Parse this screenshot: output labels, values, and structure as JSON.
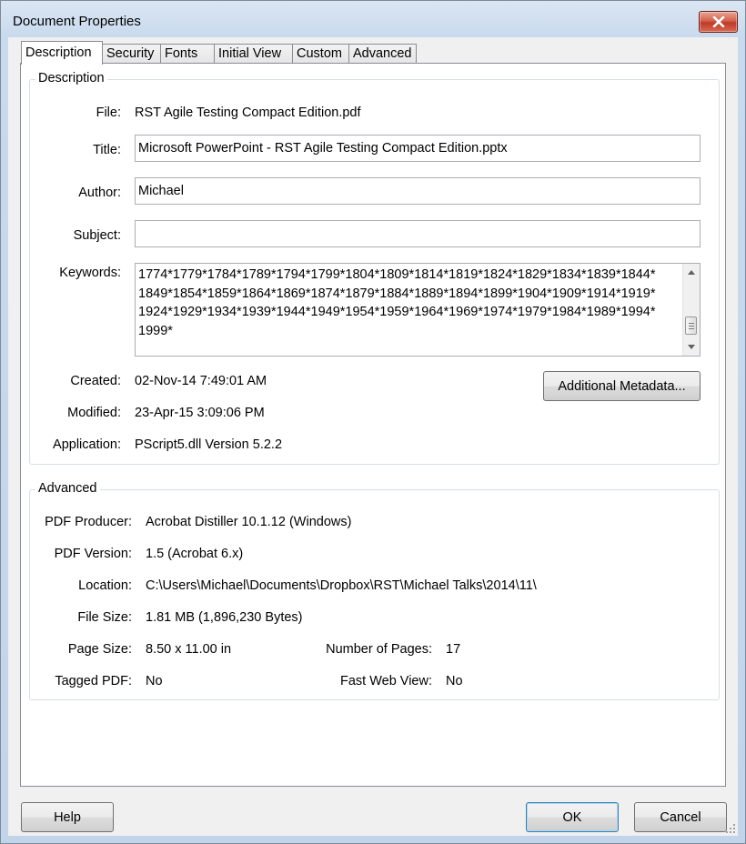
{
  "window": {
    "title": "Document Properties"
  },
  "tabs": [
    {
      "label": "Description",
      "active": true
    },
    {
      "label": "Security"
    },
    {
      "label": "Fonts"
    },
    {
      "label": "Initial View"
    },
    {
      "label": "Custom"
    },
    {
      "label": "Advanced"
    }
  ],
  "description": {
    "group_title": "Description",
    "file_label": "File:",
    "file_value": "RST Agile Testing Compact Edition.pdf",
    "title_label": "Title:",
    "title_value": "Microsoft PowerPoint - RST Agile Testing Compact Edition.pptx",
    "author_label": "Author:",
    "author_value": "Michael",
    "subject_label": "Subject:",
    "subject_value": "",
    "keywords_label": "Keywords:",
    "keywords_value": "1774*1779*1784*1789*1794*1799*1804*1809*1814*1819*1824*1829*1834*1839*1844*1849*1854*1859*1864*1869*1874*1879*1884*1889*1894*1899*1904*1909*1914*1919*1924*1929*1934*1939*1944*1949*1954*1959*1964*1969*1974*1979*1984*1989*1994*1999*",
    "created_label": "Created:",
    "created_value": "02-Nov-14 7:49:01 AM",
    "modified_label": "Modified:",
    "modified_value": "23-Apr-15 3:09:06 PM",
    "application_label": "Application:",
    "application_value": "PScript5.dll Version 5.2.2",
    "metadata_button": "Additional Metadata..."
  },
  "advanced": {
    "group_title": "Advanced",
    "producer_label": "PDF Producer:",
    "producer_value": "Acrobat Distiller 10.1.12 (Windows)",
    "version_label": "PDF Version:",
    "version_value": "1.5 (Acrobat 6.x)",
    "location_label": "Location:",
    "location_value": "C:\\Users\\Michael\\Documents\\Dropbox\\RST\\Michael Talks\\2014\\11\\",
    "filesize_label": "File Size:",
    "filesize_value": "1.81 MB (1,896,230 Bytes)",
    "pagesize_label": "Page Size:",
    "pagesize_value": "8.50 x 11.00 in",
    "pages_label": "Number of Pages:",
    "pages_value": "17",
    "tagged_label": "Tagged PDF:",
    "tagged_value": "No",
    "fastweb_label": "Fast Web View:",
    "fastweb_value": "No"
  },
  "buttons": {
    "help": "Help",
    "ok": "OK",
    "cancel": "Cancel"
  },
  "colors": {
    "titlebar": "#c9daee",
    "close": "#c0392b",
    "default_button_border": "#3c7fb1"
  },
  "icons": {
    "close": "close-icon",
    "scroll_up": "scroll-up-arrow-icon",
    "scroll_down": "scroll-down-arrow-icon",
    "resize": "resize-grip-icon"
  }
}
